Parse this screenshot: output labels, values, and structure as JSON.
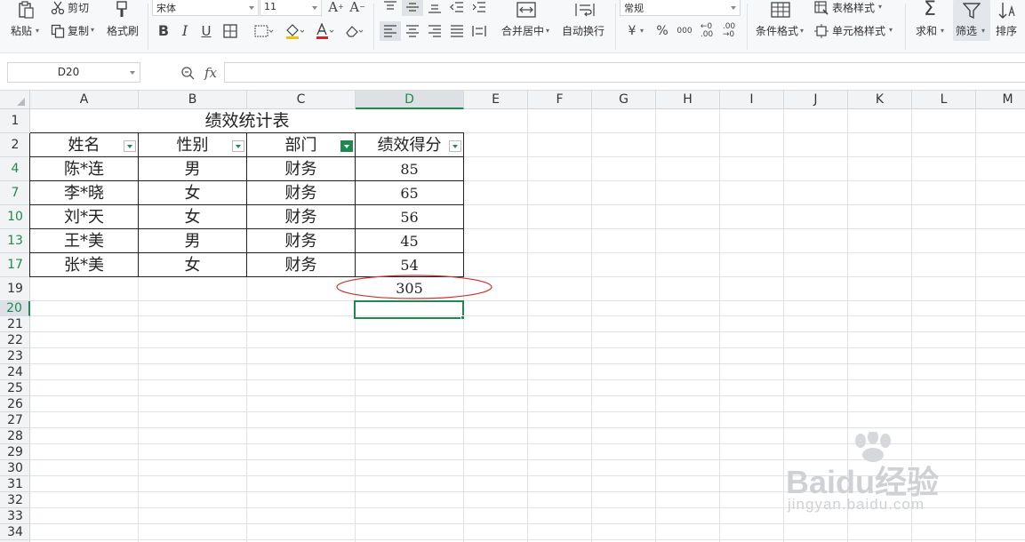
{
  "ribbon": {
    "paste_label": "粘贴",
    "cut_label": "剪切",
    "copy_label": "复制",
    "format_painter_label": "格式刷",
    "font_name": "宋体",
    "font_size": "11",
    "bold": "B",
    "italic": "I",
    "underline": "U",
    "merge_center_label": "合并居中",
    "wrap_text_label": "自动换行",
    "number_format": "常规",
    "currency_symbol": "¥",
    "percent_symbol": "%",
    "thousands_symbol": "000",
    "conditional_format_label": "条件格式",
    "table_style_label": "表格样式",
    "cell_style_label": "单元格样式",
    "sum_label": "求和",
    "filter_label": "筛选",
    "sort_label": "排序"
  },
  "formula_bar": {
    "cell_ref": "D20",
    "fx": "fx",
    "content": ""
  },
  "columns": [
    "A",
    "B",
    "C",
    "D",
    "E",
    "F",
    "G",
    "H",
    "I",
    "J",
    "K",
    "L",
    "M"
  ],
  "selected_column": "D",
  "rows_visible": [
    "1",
    "2",
    "4",
    "7",
    "10",
    "13",
    "17",
    "19",
    "20",
    "21",
    "22",
    "23",
    "24",
    "25",
    "26",
    "27",
    "28",
    "29",
    "30",
    "31",
    "32",
    "33",
    "34"
  ],
  "filtered_row_headers": [
    "4",
    "7",
    "10",
    "13",
    "17"
  ],
  "selected_row": "20",
  "table": {
    "title": "绩效统计表",
    "headers": [
      "姓名",
      "性别",
      "部门",
      "绩效得分"
    ],
    "rows": [
      [
        "陈*连",
        "男",
        "财务",
        "85"
      ],
      [
        "李*晓",
        "女",
        "财务",
        "65"
      ],
      [
        "刘*天",
        "女",
        "财务",
        "56"
      ],
      [
        "王*美",
        "男",
        "财务",
        "45"
      ],
      [
        "张*美",
        "女",
        "财务",
        "54"
      ]
    ],
    "total": "305"
  },
  "active_filter_column": "部门",
  "watermark": {
    "brand": "Baidu经验",
    "url": "jingyan.baidu.com"
  },
  "colors": {
    "accent": "#1f8a4f",
    "highlight_ellipse": "#cc3333"
  }
}
